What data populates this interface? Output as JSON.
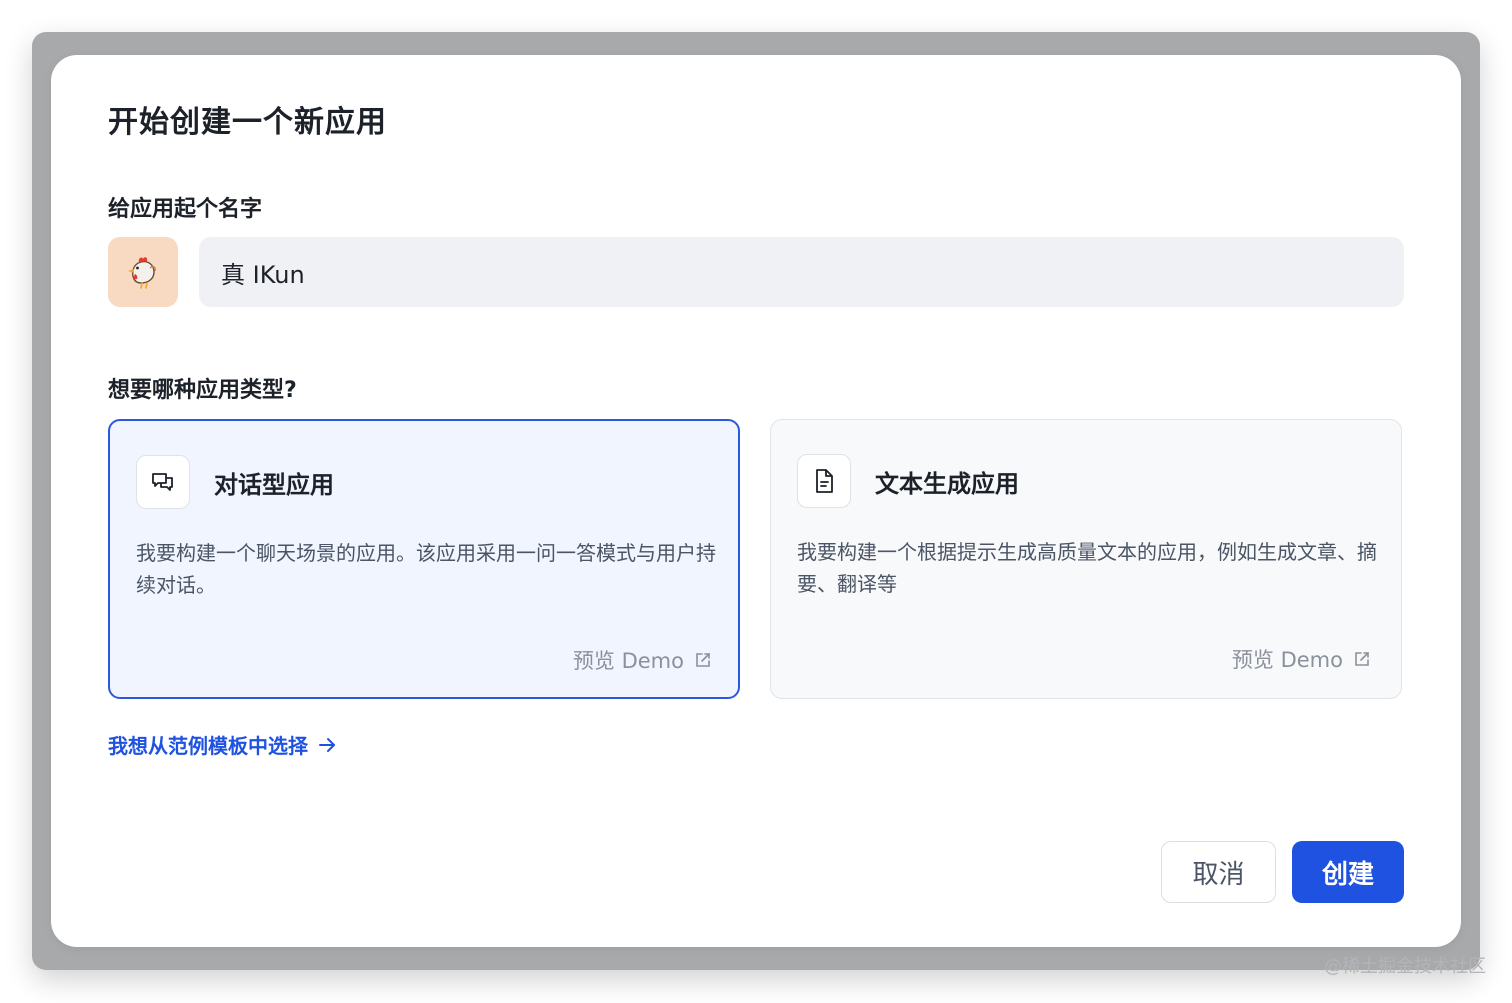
{
  "dialog": {
    "title": "开始创建一个新应用",
    "name_section_label": "给应用起个名字",
    "app_name_value": "真 IKun",
    "avatar_icon": "rooster-emoji",
    "type_section_label": "想要哪种应用类型?",
    "app_types": [
      {
        "title": "对话型应用",
        "icon": "chat-bubbles-icon",
        "description": "我要构建一个聊天场景的应用。该应用采用一问一答模式与用户持续对话。",
        "demo_label": "预览 Demo",
        "selected": true
      },
      {
        "title": "文本生成应用",
        "icon": "document-icon",
        "description": "我要构建一个根据提示生成高质量文本的应用，例如生成文章、摘要、翻译等",
        "demo_label": "预览 Demo",
        "selected": false
      }
    ],
    "template_link_label": "我想从范例模板中选择",
    "cancel_label": "取消",
    "create_label": "创建"
  },
  "watermark": "@稀土掘金技术社区",
  "colors": {
    "primary": "#1f52e0",
    "selected_card_bg": "#f0f5ff",
    "selected_card_border": "#2c58df",
    "avatar_bg": "#f8d9c2",
    "input_bg": "#f0f1f4"
  }
}
